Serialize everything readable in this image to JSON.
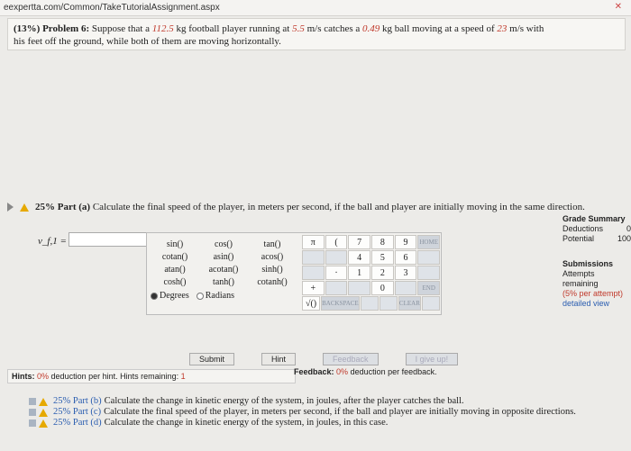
{
  "url": "eexpertta.com/Common/TakeTutorialAssignment.aspx",
  "problem": {
    "label": "(13%) Problem 6:",
    "text_a": "Suppose that a",
    "mass1": "112.5",
    "text_b": "kg football player running at",
    "speed1": "5.5",
    "text_c": "m/s catches a",
    "mass2": "0.49",
    "text_d": "kg ball moving at a speed of",
    "speed2": "23",
    "text_e": "m/s with",
    "line2": "his feet off the ground, while both of them are moving horizontally."
  },
  "part_a": {
    "prefix": "25% Part (a)",
    "text": "Calculate the final speed of the player, in meters per second, if the ball and player are initially moving in the same direction.",
    "var_label": "v_f,1 =",
    "answer": ""
  },
  "grade_summary": {
    "title": "Grade Summary",
    "deductions_label": "Deductions",
    "deductions_value": "0",
    "potential_label": "Potential",
    "potential_value": "100"
  },
  "submissions": {
    "title": "Submissions",
    "attempts": "Attempts remaining",
    "per_attempt": "(5% per attempt)",
    "detailed": "detailed view"
  },
  "functions": [
    [
      "sin()",
      "cos()",
      "tan()"
    ],
    [
      "cotan()",
      "asin()",
      "acos()"
    ],
    [
      "atan()",
      "acotan()",
      "sinh()"
    ],
    [
      "cosh()",
      "tanh()",
      "cotanh()"
    ]
  ],
  "angle_mode": {
    "degrees": "Degrees",
    "radians": "Radians"
  },
  "keypad": [
    [
      "π",
      "(",
      "7",
      "8",
      "9",
      "HOME"
    ],
    [
      "",
      "",
      "4",
      "5",
      "6",
      ""
    ],
    [
      "",
      "·",
      "1",
      "2",
      "3",
      ""
    ],
    [
      "+",
      "",
      "",
      "0",
      "",
      "END"
    ],
    [
      "√()",
      "BACKSPACE",
      "",
      "",
      "CLEAR",
      ""
    ]
  ],
  "buttons": {
    "submit": "Submit",
    "hint": "Hint",
    "feedback": "Feedback",
    "give_up": "I give up!"
  },
  "hints": {
    "label": "Hints:",
    "pct": "0%",
    "text": "deduction per hint. Hints remaining:",
    "remaining": "1"
  },
  "feedback": {
    "label": "Feedback:",
    "pct": "0%",
    "text": "deduction per feedback."
  },
  "other_parts": [
    {
      "prefix": "25% Part (b)",
      "text": "Calculate the change in kinetic energy of the system, in joules, after the player catches the ball."
    },
    {
      "prefix": "25% Part (c)",
      "text": "Calculate the final speed of the player, in meters per second, if the ball and player are initially moving in opposite directions."
    },
    {
      "prefix": "25% Part (d)",
      "text": "Calculate the change in kinetic energy of the system, in joules, in this case."
    }
  ]
}
